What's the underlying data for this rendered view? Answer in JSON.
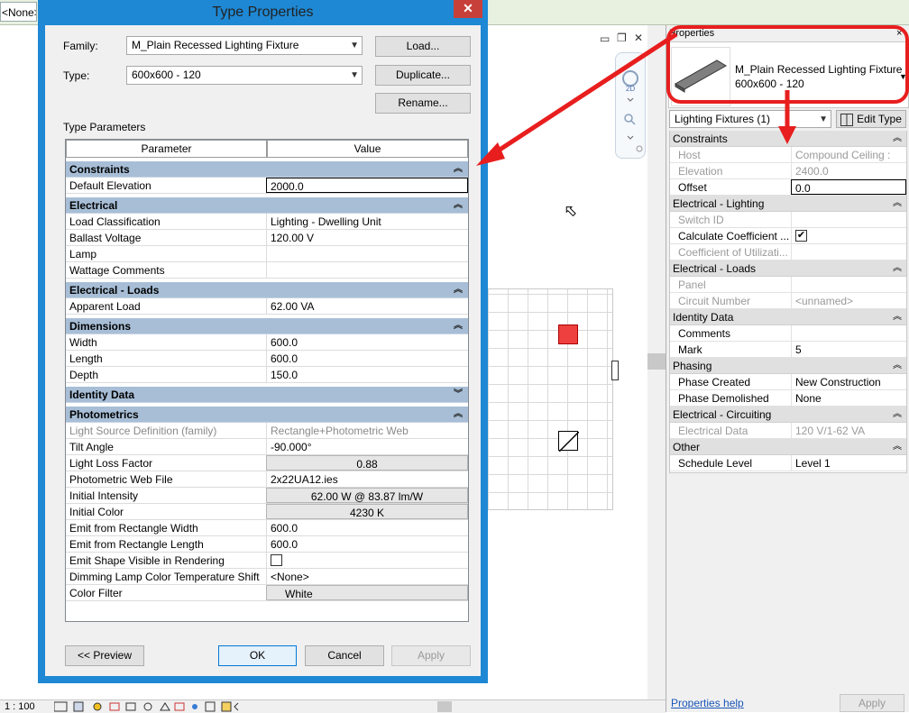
{
  "colors": {
    "dialog_frame": "#1e88d4",
    "close_button": "#c7403a",
    "group_header": "#a7bed6",
    "annotation_red": "#e81e1e",
    "fixture_red": "#ef4040"
  },
  "top": {
    "none_tab": "<None>"
  },
  "canvas": {
    "min_icon": "▭",
    "restore_icon": "❐",
    "close_icon": "✕",
    "nav_2d": "2D",
    "cursor": "⬉"
  },
  "status": {
    "scale": "1 : 100"
  },
  "dialog": {
    "title": "Type Properties",
    "close": "✕",
    "family_label": "Family:",
    "family_value": "M_Plain Recessed Lighting Fixture",
    "type_label": "Type:",
    "type_value": "600x600 - 120",
    "load": "Load...",
    "duplicate": "Duplicate...",
    "rename": "Rename...",
    "type_params_label": "Type Parameters",
    "col_param": "Parameter",
    "col_value": "Value",
    "preview": "<< Preview",
    "ok": "OK",
    "cancel": "Cancel",
    "apply": "Apply",
    "groups": [
      {
        "label": "Constraints",
        "collapsed": false
      },
      {
        "label": "Electrical",
        "collapsed": false
      },
      {
        "label": "Electrical - Loads",
        "collapsed": false
      },
      {
        "label": "Dimensions",
        "collapsed": false
      },
      {
        "label": "Identity Data",
        "collapsed": true
      },
      {
        "label": "Photometrics",
        "collapsed": false
      }
    ],
    "rows": {
      "default_elevation": {
        "name": "Default Elevation",
        "value": "2000.0"
      },
      "load_classification": {
        "name": "Load Classification",
        "value": "Lighting - Dwelling Unit"
      },
      "ballast_voltage": {
        "name": "Ballast Voltage",
        "value": "120.00 V"
      },
      "lamp": {
        "name": "Lamp",
        "value": ""
      },
      "wattage_comments": {
        "name": "Wattage Comments",
        "value": ""
      },
      "apparent_load": {
        "name": "Apparent Load",
        "value": "62.00 VA"
      },
      "width": {
        "name": "Width",
        "value": "600.0"
      },
      "length": {
        "name": "Length",
        "value": "600.0"
      },
      "depth": {
        "name": "Depth",
        "value": "150.0"
      },
      "light_source": {
        "name": "Light Source Definition (family)",
        "value": "Rectangle+Photometric Web"
      },
      "tilt_angle": {
        "name": "Tilt Angle",
        "value": "-90.000°"
      },
      "light_loss": {
        "name": "Light Loss Factor",
        "value": "0.88"
      },
      "photometric_web": {
        "name": "Photometric Web File",
        "value": "2x22UA12.ies"
      },
      "initial_intensity": {
        "name": "Initial Intensity",
        "value": "62.00 W @ 83.87 lm/W"
      },
      "initial_color": {
        "name": "Initial Color",
        "value": "4230 K"
      },
      "emit_width": {
        "name": "Emit from Rectangle Width",
        "value": "600.0"
      },
      "emit_length": {
        "name": "Emit from Rectangle Length",
        "value": "600.0"
      },
      "emit_shape": {
        "name": "Emit Shape Visible in Rendering",
        "checked": false
      },
      "dimming": {
        "name": "Dimming Lamp Color Temperature Shift",
        "value": "<None>"
      },
      "color_filter": {
        "name": "Color Filter",
        "value": "White"
      }
    }
  },
  "props": {
    "title": "Properties",
    "close": "×",
    "type_line1": "M_Plain Recessed Lighting Fixture",
    "type_line2": "600x600 - 120",
    "filter": "Lighting Fixtures (1)",
    "edit_type": "Edit Type",
    "help": "Properties help",
    "apply": "Apply",
    "groups": [
      {
        "label": "Constraints"
      },
      {
        "label": "Electrical - Lighting"
      },
      {
        "label": "Electrical - Loads"
      },
      {
        "label": "Identity Data"
      },
      {
        "label": "Phasing"
      },
      {
        "label": "Electrical - Circuiting"
      },
      {
        "label": "Other"
      }
    ],
    "rows": {
      "host": {
        "name": "Host",
        "value": "Compound Ceiling :"
      },
      "elevation": {
        "name": "Elevation",
        "value": "2400.0"
      },
      "offset": {
        "name": "Offset",
        "value": "0.0"
      },
      "switch_id": {
        "name": "Switch ID",
        "value": ""
      },
      "calc_coeff": {
        "name": "Calculate Coefficient ...",
        "checked": true
      },
      "coeff_util": {
        "name": "Coefficient of Utilizati...",
        "value": ""
      },
      "panel": {
        "name": "Panel",
        "value": ""
      },
      "circuit_number": {
        "name": "Circuit Number",
        "value": "<unnamed>"
      },
      "comments": {
        "name": "Comments",
        "value": ""
      },
      "mark": {
        "name": "Mark",
        "value": "5"
      },
      "phase_created": {
        "name": "Phase Created",
        "value": "New Construction"
      },
      "phase_demolished": {
        "name": "Phase Demolished",
        "value": "None"
      },
      "electrical_data": {
        "name": "Electrical Data",
        "value": "120 V/1-62 VA"
      },
      "schedule_level": {
        "name": "Schedule Level",
        "value": "Level 1"
      }
    }
  }
}
